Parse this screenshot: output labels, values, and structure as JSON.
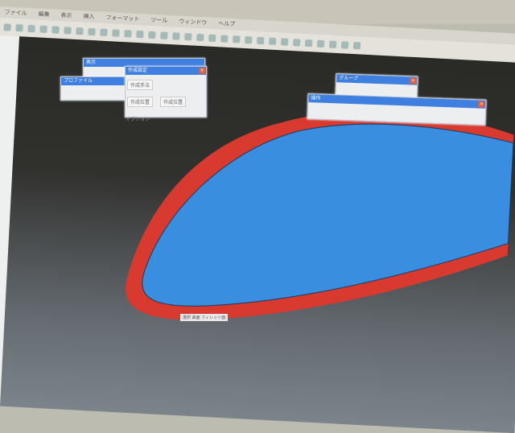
{
  "menu": {
    "items": [
      "ファイル",
      "編集",
      "表示",
      "挿入",
      "フォーマット",
      "ツール",
      "ウィンドウ",
      "ヘルプ"
    ]
  },
  "panels": {
    "profile": {
      "title": "プロファイル"
    },
    "display": {
      "title": "表示"
    },
    "options": {
      "title": "作成設定",
      "buttons": [
        "作成手法",
        "作成位置",
        "作成位置"
      ],
      "checkbox": "オプション"
    },
    "group": {
      "title": "グループ"
    },
    "tools": {
      "title": "操作"
    }
  },
  "status_label": "選択 曲面 フィレット面",
  "colors": {
    "surface": "#3a8ee0",
    "edge": "#d83a30",
    "titlebar": "#3f7fe0"
  }
}
